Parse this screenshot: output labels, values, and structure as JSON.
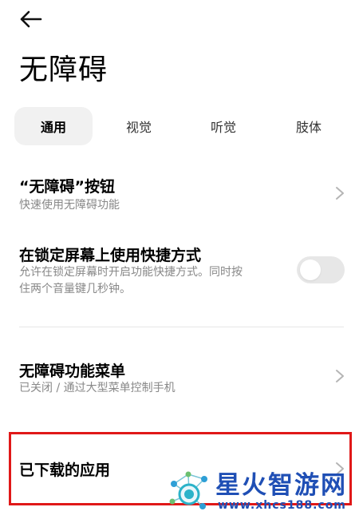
{
  "header": {
    "title": "无障碍"
  },
  "tabs": [
    {
      "label": "通用",
      "active": true
    },
    {
      "label": "视觉",
      "active": false
    },
    {
      "label": "听觉",
      "active": false
    },
    {
      "label": "肢体",
      "active": false
    }
  ],
  "settings": {
    "button": {
      "title": "“无障碍”按钮",
      "subtitle": "快速使用无障碍功能"
    },
    "lockscreen_shortcut": {
      "title": "在锁定屏幕上使用快捷方式",
      "subtitle_line1": "允许在锁定屏幕时开启功能快捷方式。同时按",
      "subtitle_line2": "住两个音量键几秒钟。",
      "enabled": false
    },
    "menu": {
      "title": "无障碍功能菜单",
      "subtitle": "已关闭 / 通过大型菜单控制手机"
    },
    "downloaded_apps": {
      "title": "已下载的应用"
    }
  },
  "watermark": {
    "name": "星火智游网",
    "url": "www.xhcs188.com"
  },
  "colors": {
    "highlight": "#e01818",
    "watermark": "#1f4fb5",
    "toggle_off": "#e7e7e7"
  }
}
